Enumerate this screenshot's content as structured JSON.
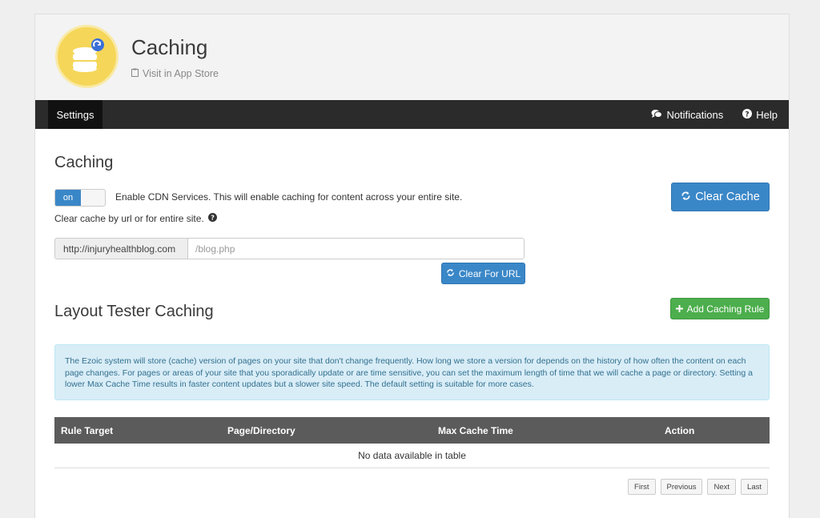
{
  "app": {
    "title": "Caching",
    "app_store_link": "Visit in App Store"
  },
  "nav": {
    "settings_tab": "Settings",
    "notifications": "Notifications",
    "help": "Help"
  },
  "caching": {
    "title": "Caching",
    "toggle_state": "on",
    "cdn_text": "Enable CDN Services. This will enable caching for content across your entire site.",
    "clear_label": "Clear cache by url or for entire site.",
    "clear_cache_button": "Clear Cache",
    "url_prefix": "http://injuryhealthblog.com",
    "url_placeholder": "/blog.php",
    "clear_for_url_button": "Clear For URL"
  },
  "layout_tester": {
    "title": "Layout Tester Caching",
    "add_rule_button": "Add Caching Rule",
    "info_text": "The Ezoic system will store (cache) version of pages on your site that don't change frequently. How long we store a version for depends on the history of how often the content on each page changes. For pages or areas of your site that you sporadically update or are time sensitive, you can set the maximum length of time that we will cache a page or directory. Setting a lower Max Cache Time results in faster content updates but a slower site speed. The default setting is suitable for more cases."
  },
  "table": {
    "columns": [
      "Rule Target",
      "Page/Directory",
      "Max Cache Time",
      "Action"
    ],
    "empty_text": "No data available in table"
  },
  "pagination": {
    "first": "First",
    "previous": "Previous",
    "next": "Next",
    "last": "Last"
  },
  "colors": {
    "primary": "#3a87c8",
    "success": "#4cae4c",
    "nav_bg": "#2b2b2b",
    "info_bg": "#d9edf7",
    "app_icon": "#f5d659"
  },
  "icons": {
    "app": "database-cloud-icon",
    "app_store": "clipboard-icon",
    "notifications": "chat-bubbles-icon",
    "help": "question-circle-icon",
    "refresh": "refresh-icon",
    "plus": "plus-icon"
  }
}
